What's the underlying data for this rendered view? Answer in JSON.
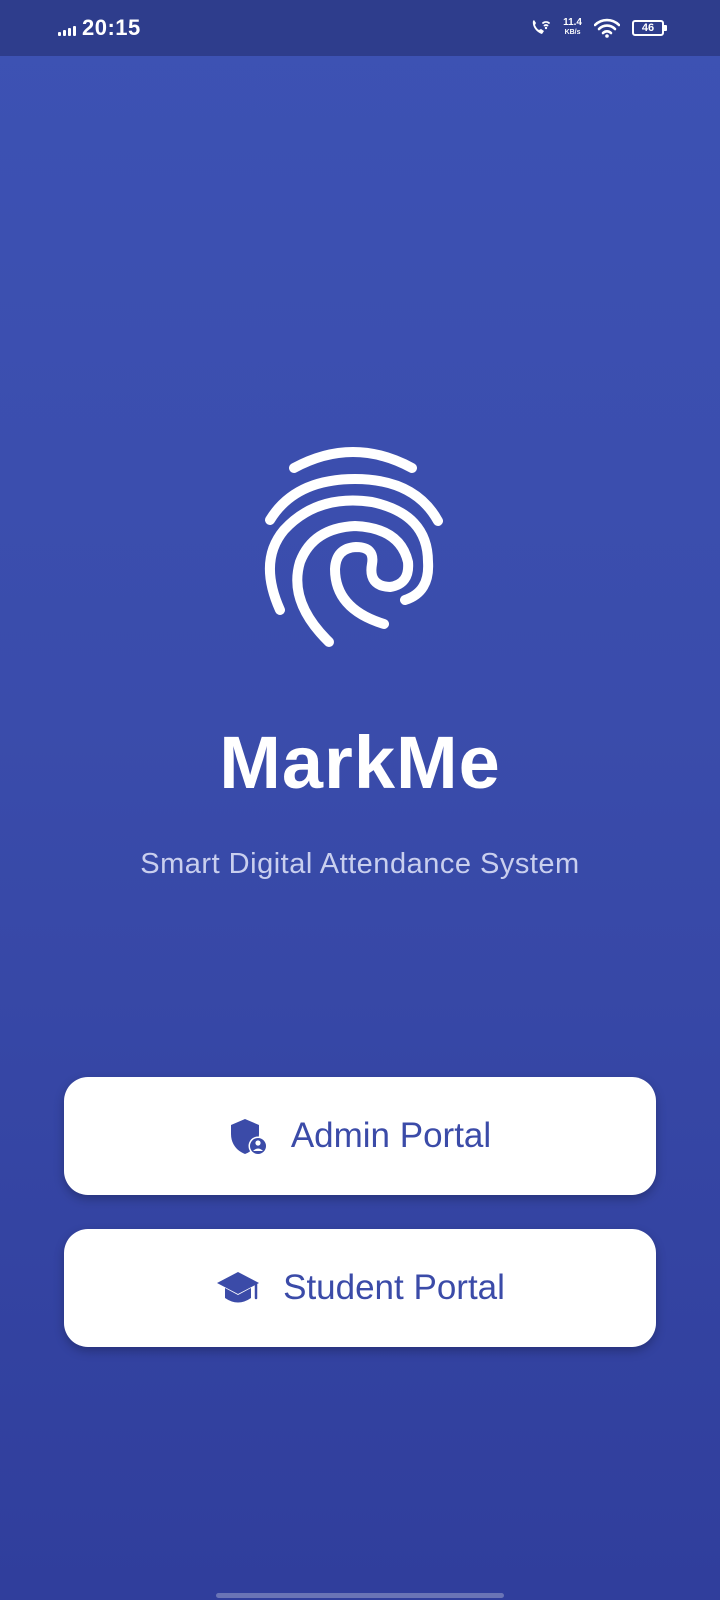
{
  "status_bar": {
    "time": "20:15",
    "net_speed_value": "11.4",
    "net_speed_unit": "KB/s",
    "battery_level": "46",
    "icons": [
      "signal-icon",
      "wifi-calling-icon",
      "wifi-icon",
      "battery-icon"
    ]
  },
  "app": {
    "title": "MarkMe",
    "subtitle": "Smart Digital Attendance System",
    "logo_icon": "fingerprint-icon"
  },
  "buttons": {
    "admin": {
      "label": "Admin Portal",
      "icon": "shield-user-icon"
    },
    "student": {
      "label": "Student Portal",
      "icon": "graduation-cap-icon"
    }
  },
  "colors": {
    "background_top": "#3d52b4",
    "background_bottom": "#303e9c",
    "status_bar": "#2e3d8c",
    "button_bg": "#ffffff",
    "button_text": "#3b4ba8",
    "subtitle_text": "#c9cfee"
  }
}
